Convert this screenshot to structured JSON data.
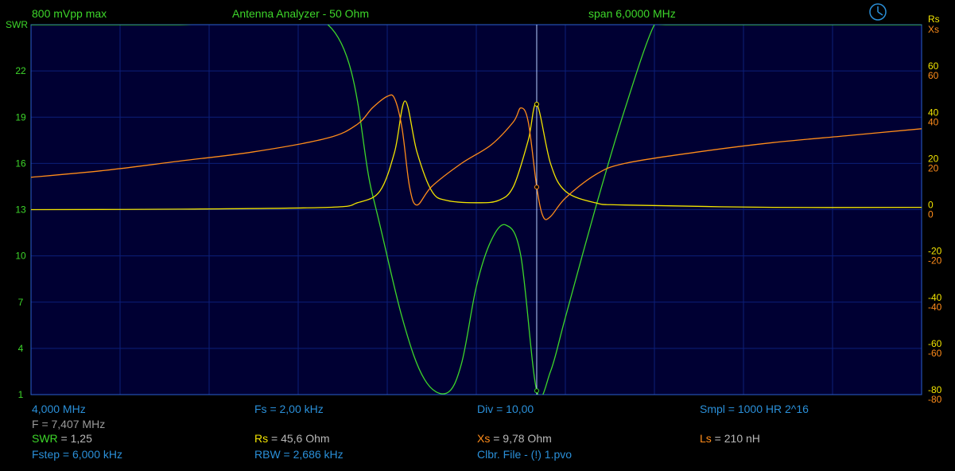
{
  "header": {
    "level": "800 mVpp max",
    "title": "Antenna Analyzer - 50 Ohm",
    "span": "span 6,0000 MHz"
  },
  "icons": {
    "clock": "clock-icon"
  },
  "axes": {
    "left_title": "SWR",
    "right_title_1": "Rs",
    "right_title_2": "Xs"
  },
  "footer": {
    "start_freq": "4,000 MHz",
    "f_marker": "F = 7,407 MHz",
    "fs": "Fs = 2,00 kHz",
    "div": "Div = 10,00",
    "smpl": "Smpl = 1000 HR  2^16",
    "swr_label": "SWR",
    "swr_value": " = 1,25",
    "rs_label": "Rs",
    "rs_value": " = 45,6 Ohm",
    "xs_label": "Xs",
    "xs_value": " = 9,78 Ohm",
    "ls_label": "Ls",
    "ls_value": " = 210 nH",
    "fstep": "Fstep = 6,000 kHz",
    "rbw": "RBW = 2,686 kHz",
    "file": "Clbr. File - (!) 1.pvo"
  },
  "colors": {
    "background": "#000000",
    "plot_bg": "#000033",
    "grid": "#0c1f7a",
    "frame": "#2a5fcf",
    "swr": "#3dd62a",
    "rs": "#f2e400",
    "xs": "#ff8c1a",
    "marker": "#b8d0ff",
    "axis_text_left": "#3dd62a",
    "axis_text_right_yellow": "#f2e400",
    "axis_text_right_orange": "#ff8c1a"
  },
  "chart_data": {
    "type": "line",
    "x_range_mhz": [
      4.0,
      10.0
    ],
    "marker_x_mhz": 7.407,
    "grid": true,
    "left_axis": {
      "label": "SWR",
      "range": [
        1,
        25
      ],
      "ticks": [
        1,
        4,
        7,
        10,
        13,
        16,
        19,
        22
      ]
    },
    "right_axis": {
      "labels": [
        "Rs",
        "Xs"
      ],
      "range": [
        -80,
        80
      ],
      "ticks_yellow": [
        60,
        40,
        20,
        0,
        -20,
        -40,
        -60,
        -80
      ],
      "ticks_orange": [
        60,
        40,
        20,
        0,
        -20,
        -40,
        -60,
        -80
      ]
    },
    "series": [
      {
        "name": "SWR",
        "x": [
          4.0,
          5.0,
          6.0,
          6.3,
          6.5,
          6.65,
          6.8,
          6.9,
          7.0,
          7.1,
          7.2,
          7.3,
          7.407,
          7.5,
          7.6,
          7.8,
          8.0,
          8.2,
          8.3,
          10.0
        ],
        "y": [
          25,
          25,
          25,
          14.0,
          6.0,
          2.0,
          1.1,
          3.0,
          8.0,
          11.0,
          12.0,
          10.0,
          1.25,
          2.5,
          6.0,
          13.0,
          19.5,
          25,
          25,
          25
        ]
      },
      {
        "name": "Rs",
        "x": [
          4.0,
          5.0,
          6.0,
          6.2,
          6.35,
          6.45,
          6.52,
          6.6,
          6.7,
          6.8,
          7.0,
          7.15,
          7.25,
          7.35,
          7.407,
          7.5,
          7.6,
          7.8,
          8.0,
          9.0,
          10.0
        ],
        "y": [
          0,
          0.2,
          1,
          3,
          8,
          25,
          47,
          25,
          8,
          4,
          3,
          4,
          10,
          30,
          45.6,
          20,
          8,
          3,
          2,
          1,
          1
        ]
      },
      {
        "name": "Xs",
        "x": [
          4.0,
          4.5,
          5.0,
          5.5,
          6.0,
          6.2,
          6.3,
          6.4,
          6.45,
          6.5,
          6.55,
          6.6,
          6.7,
          6.9,
          7.1,
          7.25,
          7.3,
          7.35,
          7.407,
          7.45,
          7.5,
          7.6,
          7.8,
          8.0,
          8.5,
          9.0,
          9.5,
          10.0
        ],
        "y": [
          14,
          17,
          21,
          25,
          31,
          37,
          44,
          49,
          48,
          35,
          10,
          2,
          10,
          20,
          28,
          38,
          44,
          38,
          9.78,
          -3,
          -3,
          5,
          15,
          20,
          25,
          29,
          32,
          35
        ]
      }
    ]
  }
}
